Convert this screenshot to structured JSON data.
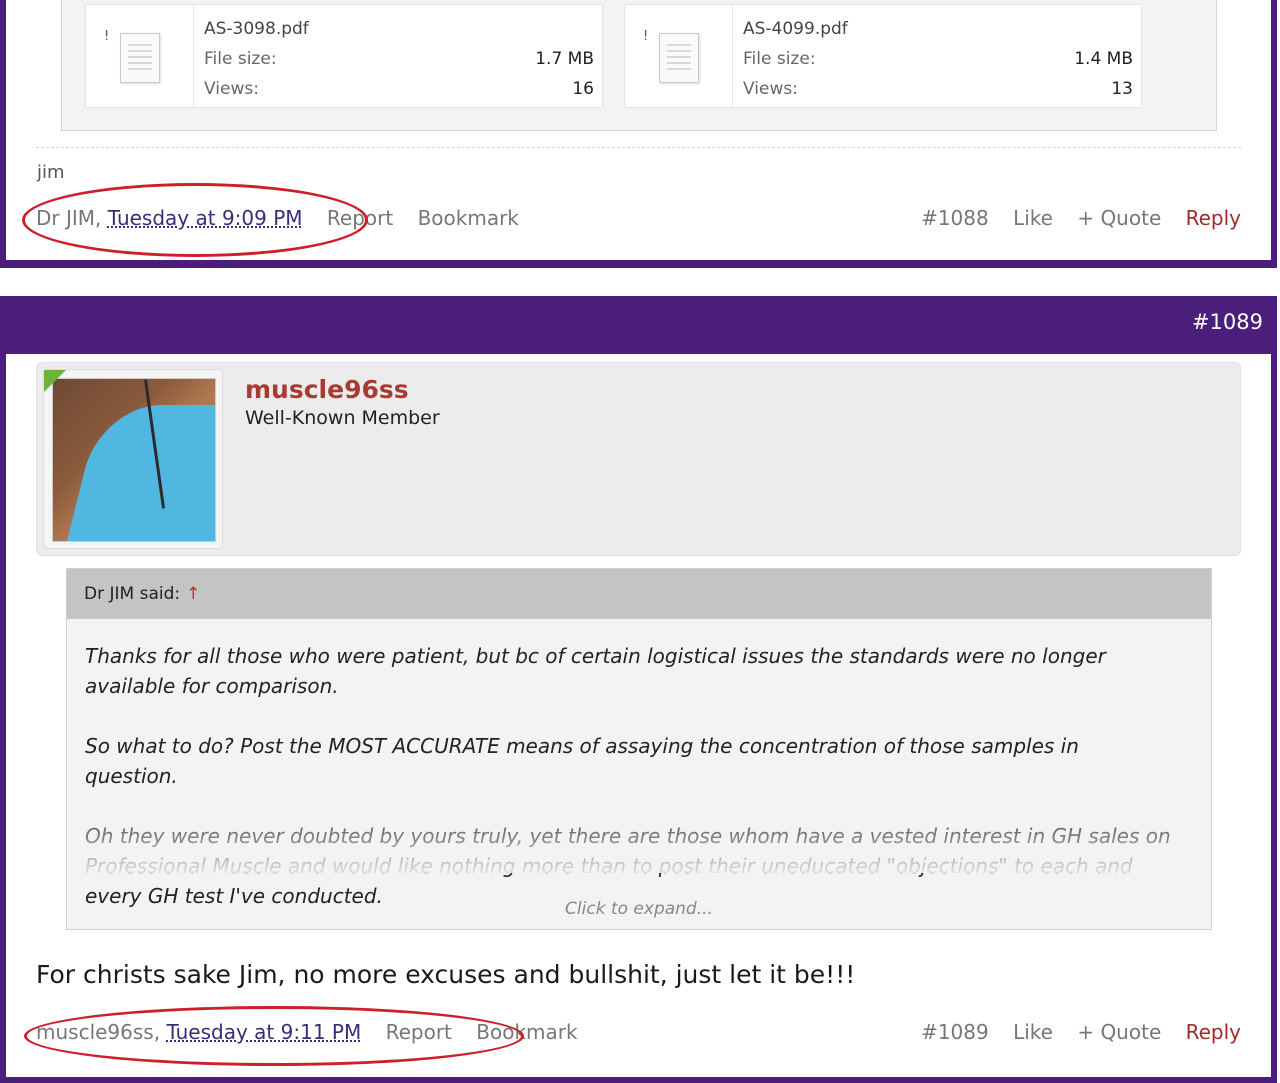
{
  "post1": {
    "attachments": [
      {
        "name": "AS-3098.pdf",
        "size_label": "File size:",
        "size": "1.7 MB",
        "views_label": "Views:",
        "views": "16",
        "mark": "!"
      },
      {
        "name": "AS-4099.pdf",
        "size_label": "File size:",
        "size": "1.4 MB",
        "views_label": "Views:",
        "views": "13",
        "mark": "!"
      }
    ],
    "signature": "jim",
    "author": "Dr JIM",
    "date": "Tuesday at 9:09 PM",
    "report": "Report",
    "bookmark": "Bookmark",
    "number": "#1088",
    "like": "Like",
    "quote": "+ Quote",
    "reply": "Reply"
  },
  "post2": {
    "header_number": "#1089",
    "username": "muscle96ss",
    "user_title": "Well-Known Member",
    "quote": {
      "attribution": "Dr JIM said:",
      "arrow": "↑",
      "paragraphs": [
        "Thanks for all those who were patient, but bc of certain logistical issues the standards were no longer available for comparison.",
        "So what to do? Post the MOST ACCURATE means of assaying the concentration of those samples in question.",
        "Oh they were never doubted by yours truly, yet there are those whom have a vested interest in GH sales on Professional Muscle and would like nothing more than to post their uneducated \"objections\" to each and every GH test I've conducted."
      ],
      "expand": "Click to expand..."
    },
    "message": "For christs sake Jim, no more excuses and bullshit, just let it be!!!",
    "author": "muscle96ss",
    "date": "Tuesday at 9:11 PM",
    "report": "Report",
    "bookmark": "Bookmark",
    "number": "#1089",
    "like": "Like",
    "quote_btn": "+ Quote",
    "reply": "Reply"
  },
  "colors": {
    "frame": "#4a1e7a",
    "annotation": "#cc1f2a",
    "username": "#a83a34",
    "reply": "#a02a2a",
    "date_link": "#3d2a7a"
  }
}
